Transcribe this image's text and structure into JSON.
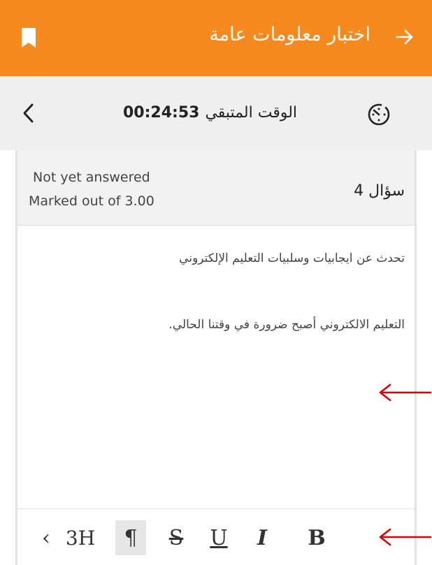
{
  "header": {
    "title": "اختبار معلومات عامة",
    "back_icon": "arrow-right-icon",
    "bookmark_icon": "bookmark-icon",
    "background": "#f68a1e"
  },
  "timer": {
    "label": "الوقت المتبقي",
    "value": "00:24:53",
    "icon": "timer-icon",
    "nav_icon": "chevron-left-icon"
  },
  "question": {
    "number_label": "سؤال 4",
    "status": "Not yet answered",
    "marks": "Marked out of 3.00",
    "text": "تحدث عن ايجابيات وسلبيات التعليم الإلكتروني",
    "answer": "التعليم الالكتروني أصبح ضرورة في وقتنا الحالي."
  },
  "toolbar": {
    "prev": "‹",
    "heading": "3H",
    "paragraph": "¶",
    "strike": "S",
    "underline": "U",
    "italic": "I",
    "bold": "B"
  },
  "annotation_color": "#e00000"
}
